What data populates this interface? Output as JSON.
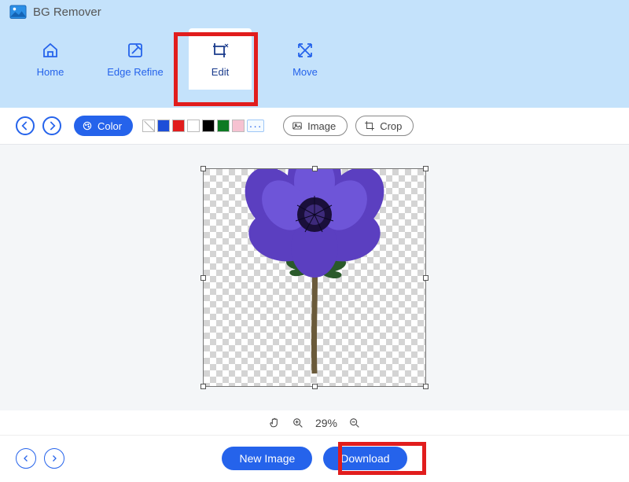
{
  "app": {
    "title": "BG Remover"
  },
  "nav": {
    "home": "Home",
    "edge_refine": "Edge Refine",
    "edit": "Edit",
    "move": "Move",
    "active": "edit"
  },
  "toolbar": {
    "undo_icon": "undo-arrow-icon",
    "redo_icon": "redo-arrow-icon",
    "color_label": "Color",
    "swatches": {
      "none": "none",
      "blue": "#1d4ed8",
      "red": "#e11d1d",
      "white": "#ffffff",
      "black": "#000000",
      "green": "#0d7a23",
      "pink": "#f6c2d1",
      "more": "···"
    },
    "image_label": "Image",
    "crop_label": "Crop"
  },
  "canvas": {
    "subject": "purple-anemone-flower",
    "selection_handles": 8
  },
  "zoom": {
    "pan_icon": "hand-pan-icon",
    "in_icon": "zoom-in-icon",
    "out_icon": "zoom-out-icon",
    "value": "29%"
  },
  "footer": {
    "prev_icon": "chevron-left-icon",
    "next_icon": "chevron-right-icon",
    "new_image_label": "New Image",
    "download_label": "Download"
  },
  "highlights": {
    "edit_tab": true,
    "download_btn": true
  },
  "colors": {
    "accent": "#2563eb",
    "header_bg": "#c4e2fb",
    "highlight": "#e11d1d"
  }
}
